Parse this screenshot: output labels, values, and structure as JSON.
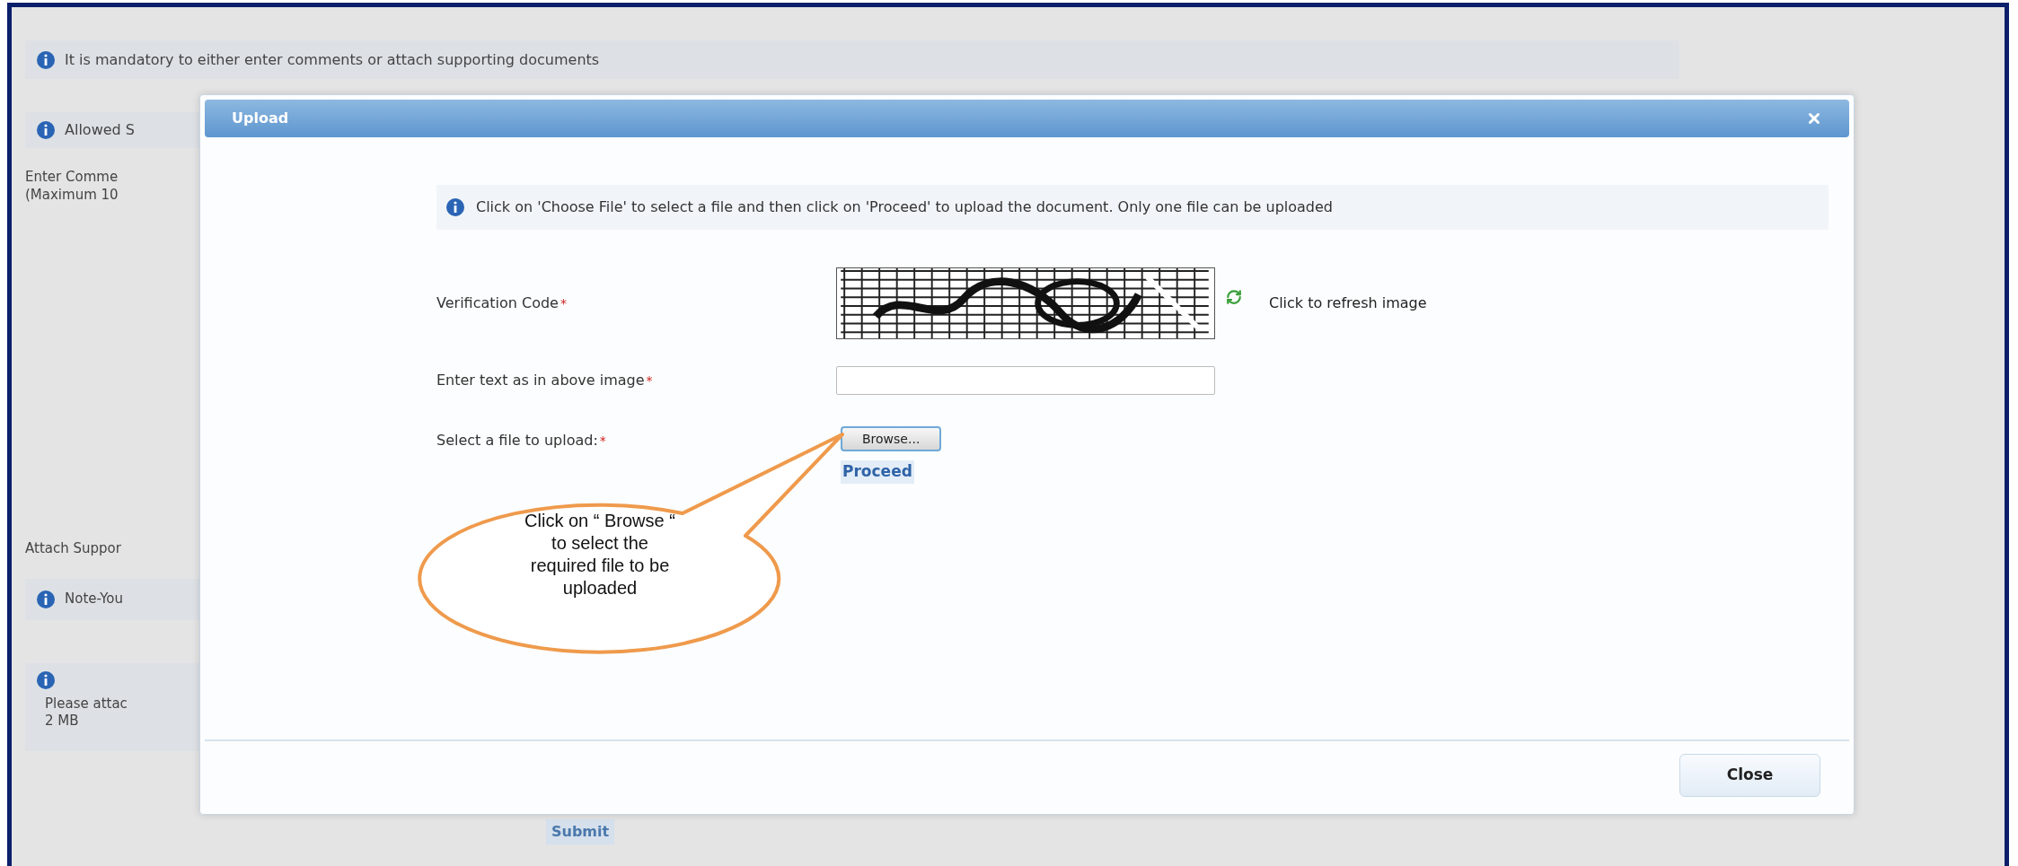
{
  "page": {
    "mandatory_notice": "It is mandatory to either enter comments or attach supporting documents",
    "allowed_notice": "Allowed S",
    "comments_label": [
      "Enter Comme",
      "(Maximum 10"
    ],
    "attach_label": "Attach Suppor",
    "note": "Note-You",
    "size_notice": [
      "Please attac",
      "2 MB"
    ],
    "submit_button": "Submit"
  },
  "dialog": {
    "title": "Upload",
    "info": "Click on 'Choose File' to select a file and then click on 'Proceed' to upload the document. Only one file can be uploaded",
    "fields": [
      {
        "kind": "captcha",
        "label": "Verification Code",
        "required_mark": "*",
        "refresh_link": "Click to refresh image"
      },
      {
        "kind": "text",
        "label": "Enter text as in above image",
        "required_mark": "*"
      },
      {
        "kind": "file",
        "label": "Select a file to upload:",
        "required_mark": "*",
        "button": "Browse...",
        "link": "Proceed"
      }
    ],
    "close_button": "Close"
  },
  "callout": {
    "lines": [
      "Click on “ Browse “",
      "to select the",
      "required file to be",
      "uploaded"
    ]
  }
}
